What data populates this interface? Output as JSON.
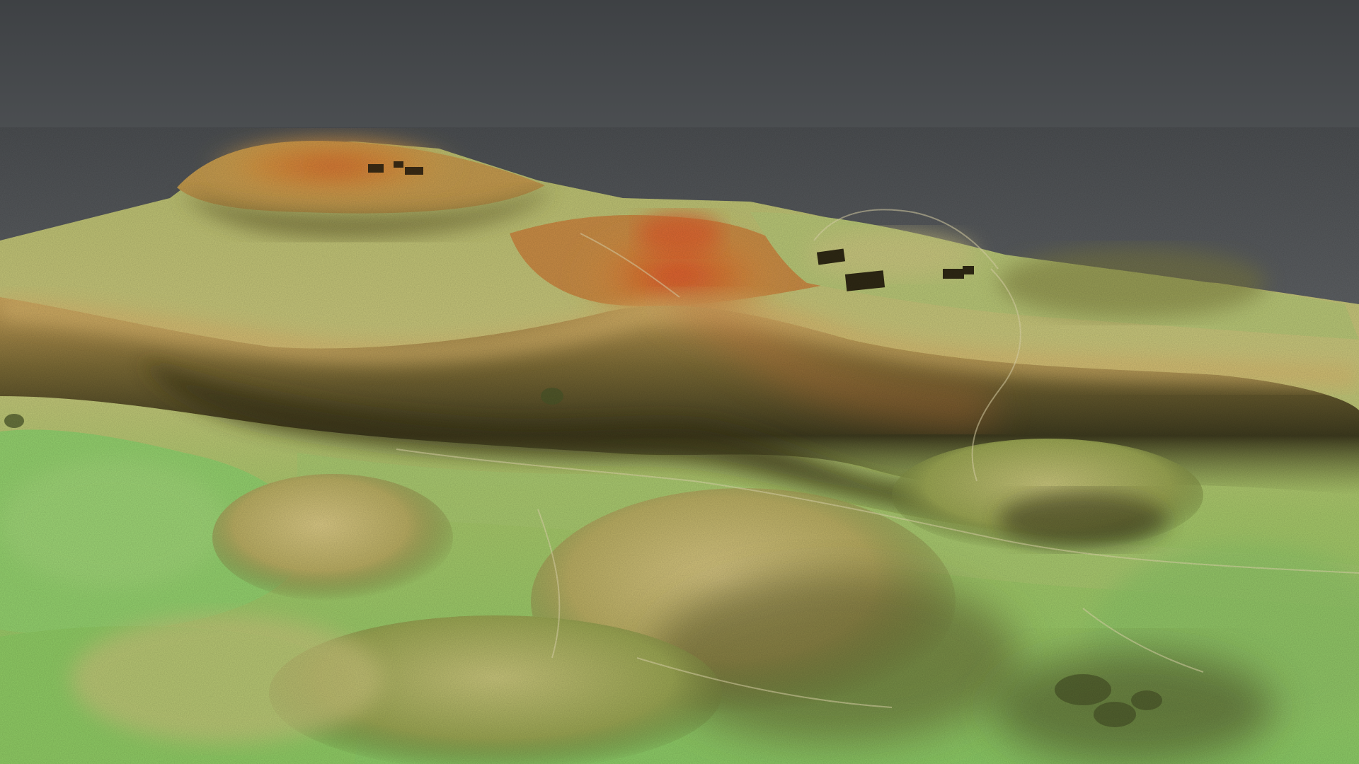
{
  "scene": {
    "kind": "3d-shaded-relief-terrain",
    "colors": {
      "sky_top": "#3f4245",
      "sky_bottom": "#8a8d90",
      "elevation_low": "#8fcf6a",
      "elevation_mid": "#c8c070",
      "elevation_high": "#c9803c",
      "elevation_peak": "#e2582a",
      "shadow": "#2c2a18"
    },
    "features": [
      "summit-plateau-left",
      "saddle-peak-center",
      "buildings-right",
      "buildings-summit",
      "ridge-escarpment",
      "valley-floor",
      "lower-hills"
    ]
  }
}
